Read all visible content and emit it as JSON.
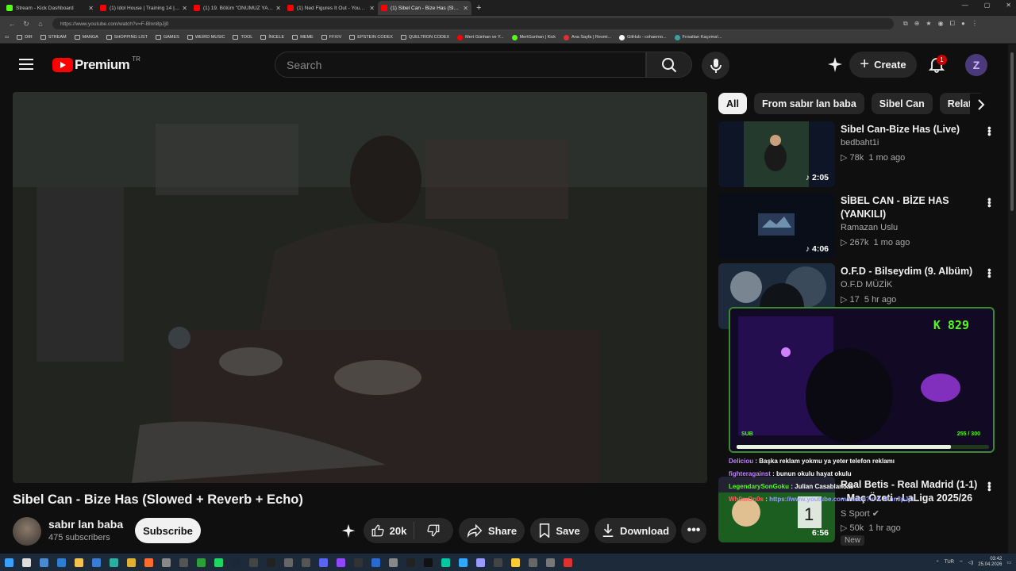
{
  "browser": {
    "tabs": [
      {
        "title": "Stream - Kick Dashboard",
        "color": "#53fc18"
      },
      {
        "title": "(1) Idol House | Training 14 | Glam",
        "color": "#ff0000"
      },
      {
        "title": "(1) 19. Bölüm \"ÖNÜMÜZ YAZ\" Po",
        "color": "#ff0000"
      },
      {
        "title": "(1) Ned Figures It Out - YouTube",
        "color": "#ff0000"
      },
      {
        "title": "(1) Sibel Can - Bize Has (Slowed +",
        "color": "#ff0000"
      }
    ],
    "url": "https://www.youtube.com/watch?v=F-Blnn8pJj0",
    "bookmarks": [
      {
        "label": "DIR",
        "type": "folder"
      },
      {
        "label": "STREAM",
        "type": "folder"
      },
      {
        "label": "MANGA",
        "type": "folder"
      },
      {
        "label": "SHOPPING LIST",
        "type": "folder"
      },
      {
        "label": "GAMES",
        "type": "folder"
      },
      {
        "label": "WEIRD MUSIC",
        "type": "folder"
      },
      {
        "label": "TOOL",
        "type": "folder"
      },
      {
        "label": "İNCELE",
        "type": "folder"
      },
      {
        "label": "MEME",
        "type": "folder"
      },
      {
        "label": "FFXIV",
        "type": "folder"
      },
      {
        "label": "EPSTEIN CODEX",
        "type": "folder"
      },
      {
        "label": "QUELTRON CODEX",
        "type": "folder"
      },
      {
        "label": "Mert Günhan ve Y...",
        "type": "site",
        "color": "#ff0000"
      },
      {
        "label": "MertGunhan | Kick",
        "type": "site",
        "color": "#53fc18"
      },
      {
        "label": "Ana Sayfa | Resmi...",
        "type": "site",
        "color": "#e03030"
      },
      {
        "label": "GitHub - cohaerno...",
        "type": "site",
        "color": "#ffffff"
      },
      {
        "label": "Fırsatları Kaçırma!...",
        "type": "site",
        "color": "#3aa0a0"
      }
    ]
  },
  "youtube": {
    "logo_text": "Premium",
    "country": "TR",
    "search_placeholder": "Search",
    "create_label": "Create",
    "notification_count": "1",
    "video": {
      "title": "Sibel Can - Bize Has (Slowed + Reverb + Echo)",
      "channel": "sabır lan baba",
      "subscribers": "475 subscribers",
      "subscribe_label": "Subscribe",
      "likes": "20k",
      "share_label": "Share",
      "save_label": "Save",
      "download_label": "Download"
    },
    "chips": [
      "All",
      "From sabır lan baba",
      "Sibel Can",
      "Relate"
    ],
    "recommendations": [
      {
        "title": "Sibel Can-Bize Has (Live)",
        "channel": "bedbaht1i",
        "views": "78k",
        "age": "1 mo ago",
        "duration": "2:05"
      },
      {
        "title": "SİBEL CAN - BİZE HAS (YANKILI)",
        "channel": "Ramazan Uslu",
        "views": "267k",
        "age": "1 mo ago",
        "duration": "4:06"
      },
      {
        "title": "O.F.D - Bilseydim (9. Albüm)",
        "channel": "O.F.D MÜZİK",
        "views": "17",
        "age": "5 hr ago",
        "duration": ""
      },
      {
        "title": "Real Betis - Real Madrid (1-1) - Maç Özeti - LaLiga 2025/26",
        "channel": "S Sport",
        "views": "50k",
        "age": "1 hr ago",
        "duration": "6:56",
        "badge": "New"
      }
    ]
  },
  "stream_overlay": {
    "counter": "K 829",
    "sub_label": "SUB",
    "sub_progress": "255 / 300",
    "sub_fraction": 0.85,
    "chat": [
      {
        "user": "Deliciou",
        "text": "Başka reklam yokmu ya yeter telefon reklamı",
        "color": "#c080ff"
      },
      {
        "user": "fighteragainst",
        "text": "bunun okulu hayat okulu",
        "color": "#c080ff"
      },
      {
        "user": "LegendarySonGoku",
        "text": "Julian Casablancas",
        "color": "#53fc18"
      },
      {
        "user": "Wh0mOn0s",
        "text": "https://www.youtube.com/watch?v=F-Blnn8pJj0",
        "color": "#ff6060"
      }
    ]
  },
  "taskbar": {
    "language": "TUR",
    "time": "03:42",
    "date": "25.04.2026"
  }
}
